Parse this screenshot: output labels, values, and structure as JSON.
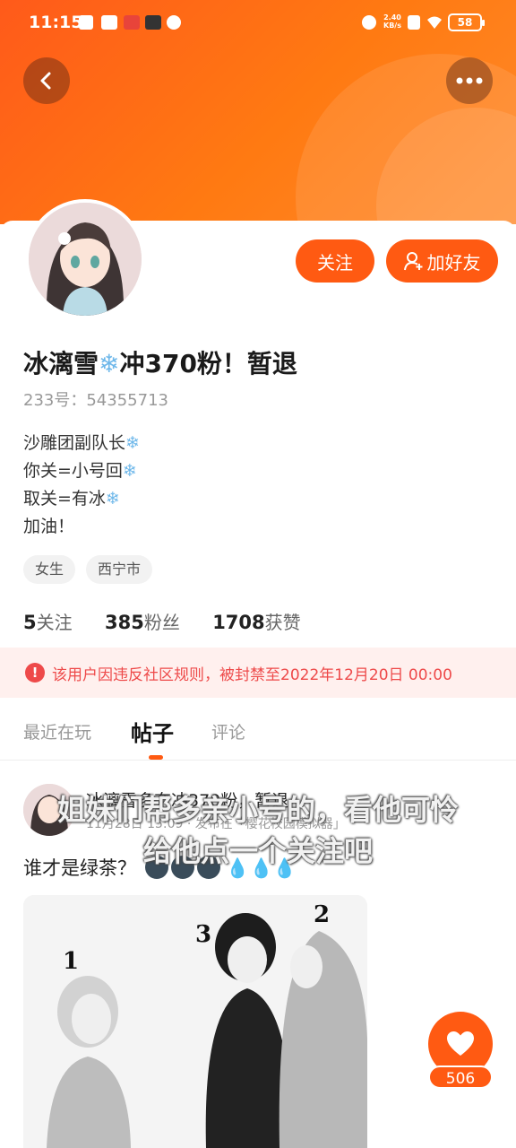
{
  "status_bar": {
    "time": "11:15",
    "net_speed_value": "2.40",
    "net_speed_unit": "KB/s",
    "battery": "58"
  },
  "header": {
    "back_icon": "chevron-left-icon",
    "more_icon": "more-dots-icon",
    "gradient_color": "#ff6a14"
  },
  "profile": {
    "follow_label": "关注",
    "add_friend_label": "加好友",
    "username_prefix": "冰漓雪",
    "username_suffix": "冲370粉！暂退",
    "user_id": "233号：54355713",
    "bio": [
      "沙雕团副队长",
      "你关=小号回",
      "取关=有冰",
      "加油！"
    ],
    "tags": [
      "女生",
      "西宁市"
    ],
    "stats": {
      "following_count": "5",
      "following_label": "关注",
      "fans_count": "385",
      "fans_label": "粉丝",
      "likes_count": "1708",
      "likes_label": "获赞"
    },
    "ban_notice": "该用户因违反社区规则，被封禁至2022年12月20日 00:00"
  },
  "tabs": [
    "最近在玩",
    "帖子",
    "评论"
  ],
  "active_tab": "帖子",
  "post": {
    "author": "冰漓雪多奈冲370粉，暂退",
    "meta": "11月28日 15:09 · 发布在「樱花校园模拟器」",
    "title": "谁才是绿茶？",
    "image_labels": [
      "1",
      "2",
      "3"
    ]
  },
  "subtitles": [
    "姐妹们帮多亲小号的，看他可怜",
    "给他点一个关注吧"
  ],
  "like": {
    "count": "506",
    "icon": "heart-icon"
  },
  "accent_color": "#ff5a12",
  "ban_color": "#ee4a4a"
}
